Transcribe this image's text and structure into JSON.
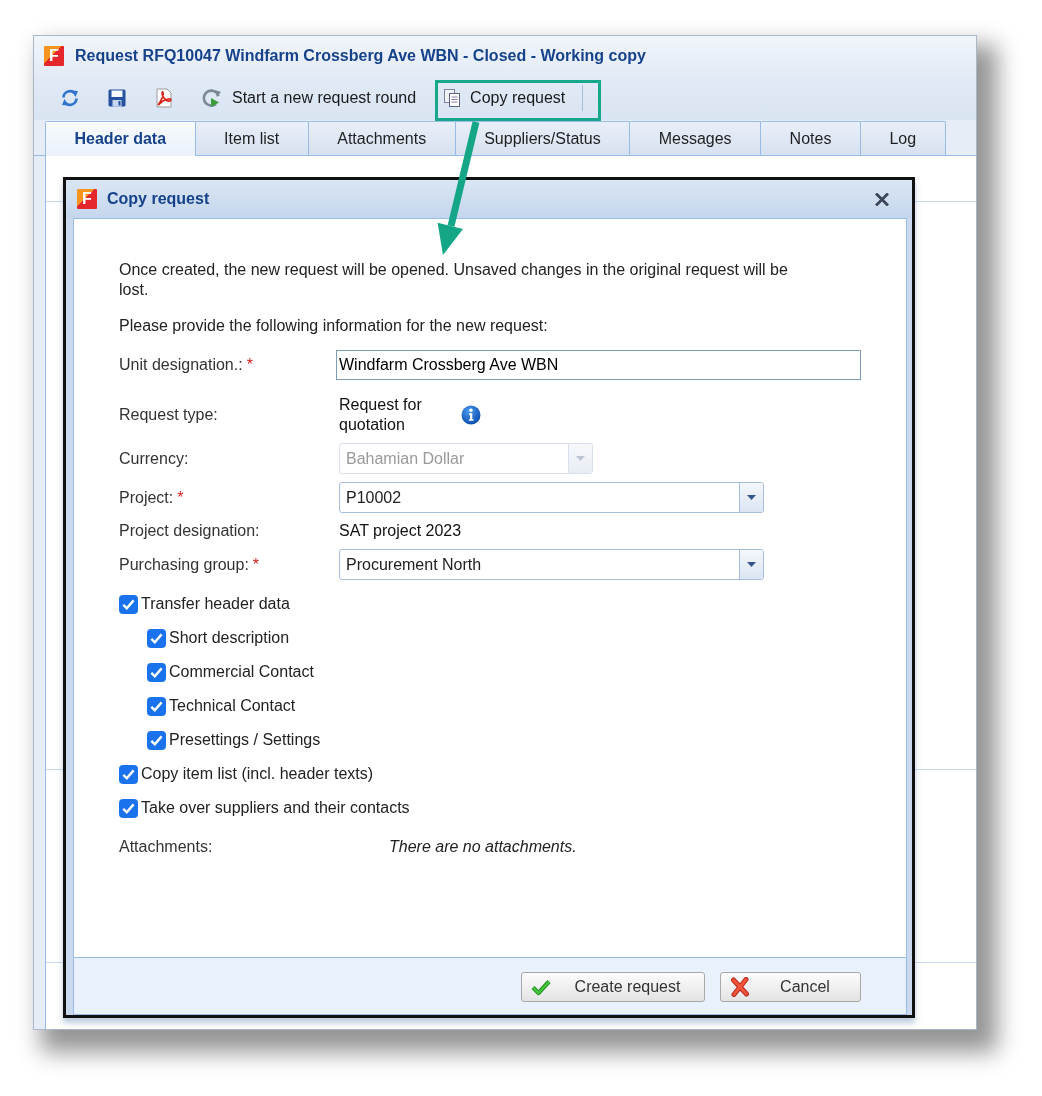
{
  "window": {
    "logo": "F",
    "title": "Request RFQ10047 Windfarm Crossberg Ave WBN - Closed - Working copy"
  },
  "toolbar": {
    "buttons": [
      {
        "label": "Start a new request round",
        "highlighted": false
      },
      {
        "label": "Copy request",
        "highlighted": true
      }
    ]
  },
  "tabs": [
    {
      "label": "Header data",
      "selected": true
    },
    {
      "label": "Item list",
      "selected": false
    },
    {
      "label": "Attachments",
      "selected": false
    },
    {
      "label": "Suppliers/Status",
      "selected": false
    },
    {
      "label": "Messages",
      "selected": false
    },
    {
      "label": "Notes",
      "selected": false
    },
    {
      "label": "Log",
      "selected": false
    }
  ],
  "dialog": {
    "logo": "F",
    "title": "Copy request",
    "intro": "Once created, the new request will be opened. Unsaved changes in the original request will be lost.",
    "prompt": "Please provide the following information for the new request:",
    "fields": [
      {
        "kind": "text",
        "label": "Unit designation.:",
        "required_mark": "*",
        "value": "Windfarm Crossberg Ave WBN",
        "disabled": false
      },
      {
        "kind": "info",
        "label": "Request type:",
        "value": "Request for quotation",
        "disabled": false
      },
      {
        "kind": "combo",
        "label": "Currency:",
        "value": "Bahamian Dollar",
        "disabled": true
      },
      {
        "kind": "combo",
        "label": "Project:",
        "required_mark": "*",
        "value": "P10002",
        "disabled": false
      },
      {
        "kind": "static",
        "label": "Project designation:",
        "value": "SAT project 2023",
        "disabled": false
      },
      {
        "kind": "combo",
        "label": "Purchasing group:",
        "required_mark": "*",
        "value": "Procurement North",
        "disabled": false
      }
    ],
    "options": [
      {
        "label": "Transfer header data",
        "checked": true,
        "children": [
          {
            "label": "Short description",
            "checked": true
          },
          {
            "label": "Commercial Contact",
            "checked": true
          },
          {
            "label": "Technical Contact",
            "checked": true
          },
          {
            "label": "Presettings / Settings",
            "checked": true
          }
        ]
      },
      {
        "label": "Copy item list (incl. header texts)",
        "checked": true
      },
      {
        "label": "Take over suppliers and their contacts",
        "checked": true
      }
    ],
    "attachments": {
      "label": "Attachments:",
      "value": "There are no attachments."
    },
    "buttons": [
      {
        "kind": "confirm",
        "label": "Create request"
      },
      {
        "kind": "cancel",
        "label": "Cancel"
      }
    ]
  }
}
